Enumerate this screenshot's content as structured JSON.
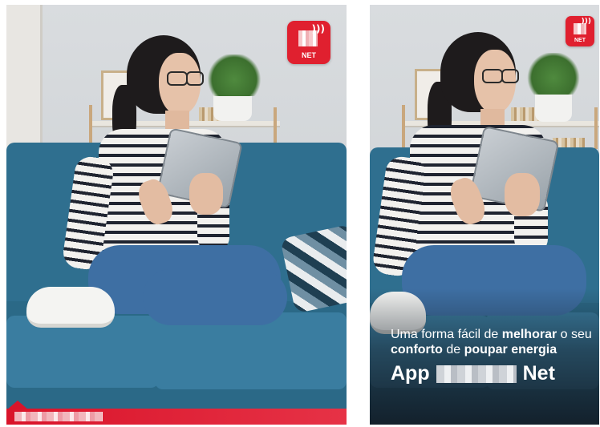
{
  "ad_left": {
    "logo_text": "NET"
  },
  "ad_right": {
    "logo_text": "NET",
    "tagline": {
      "part1": "Uma forma fácil de ",
      "part2": "melhorar",
      "part3": " o seu ",
      "part4": "conforto",
      "part5": " de ",
      "part6": "poupar energia"
    },
    "title_prefix": "App",
    "title_suffix": "Net"
  },
  "colors": {
    "brand_red": "#e0202f",
    "sofa_blue": "#2f6f8f"
  }
}
